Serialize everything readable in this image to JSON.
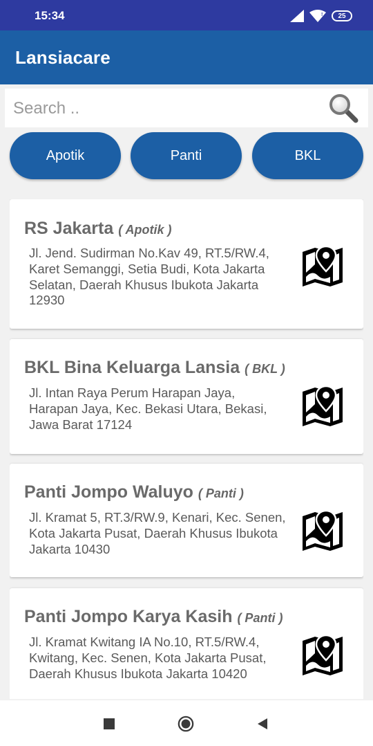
{
  "status_bar": {
    "time": "15:34",
    "battery": "25",
    "icons": [
      "signal-icon",
      "wifi-icon",
      "battery-icon"
    ]
  },
  "app_bar": {
    "title": "Lansiacare",
    "color": "#1c5fa5"
  },
  "search": {
    "placeholder": "Search ..",
    "value": "",
    "icon": "search-icon"
  },
  "filters": [
    {
      "label": "Apotik"
    },
    {
      "label": "Panti"
    },
    {
      "label": "BKL"
    }
  ],
  "places": [
    {
      "name": "RS Jakarta",
      "type": "( Apotik )",
      "address": "Jl. Jend. Sudirman No.Kav 49, RT.5/RW.4, Karet Semanggi, Setia Budi, Kota Jakarta Selatan, Daerah Khusus Ibukota Jakarta 12930",
      "icon": "map-pin-icon"
    },
    {
      "name": "BKL Bina Keluarga Lansia",
      "type": "( BKL )",
      "address": "Jl. Intan Raya Perum Harapan Jaya, Harapan Jaya, Kec. Bekasi Utara, Bekasi, Jawa Barat 17124",
      "icon": "map-pin-icon"
    },
    {
      "name": "Panti Jompo Waluyo",
      "type": "( Panti )",
      "address": "Jl. Kramat 5, RT.3/RW.9, Kenari, Kec. Senen, Kota Jakarta Pusat, Daerah Khusus Ibukota Jakarta 10430",
      "icon": "map-pin-icon"
    },
    {
      "name": "Panti Jompo Karya Kasih",
      "type": "( Panti )",
      "address": "Jl. Kramat Kwitang IA No.10, RT.5/RW.4, Kwitang, Kec. Senen, Kota Jakarta Pusat, Daerah Khusus Ibukota Jakarta 10420",
      "icon": "map-pin-icon"
    }
  ],
  "nav_bar": {
    "icons": [
      "recents-square-icon",
      "home-circle-icon",
      "back-triangle-icon"
    ]
  }
}
